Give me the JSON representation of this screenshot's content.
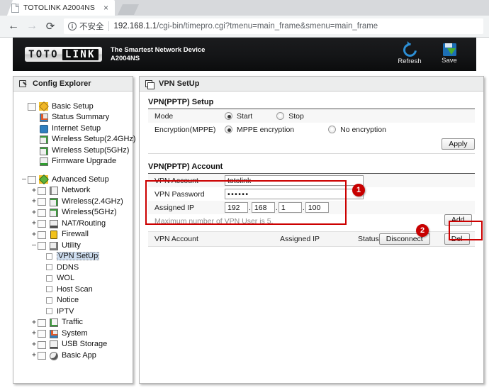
{
  "browser": {
    "tab": {
      "title": "TOTOLINK A2004NS",
      "close_label": "×"
    },
    "nav": {
      "back": "←",
      "forward": "→",
      "reload": "⟳"
    },
    "omnibox": {
      "security_icon_glyph": "i",
      "security_text": "不安全",
      "url_host": "192.168.1.1",
      "url_path": "/cgi-bin/timepro.cgi?tmenu=main_frame&smenu=main_frame"
    }
  },
  "header": {
    "logo_part1": "TOTO",
    "logo_part2": "LINK",
    "tagline_line1": "The Smartest Network Device",
    "tagline_line2": "A2004NS",
    "actions": [
      {
        "name": "refresh",
        "label": "Refresh"
      },
      {
        "name": "save",
        "label": "Save"
      }
    ]
  },
  "sidebar": {
    "title": "Config Explorer",
    "basic": {
      "label": "Basic Setup",
      "children": [
        {
          "label": "Status Summary"
        },
        {
          "label": "Internet Setup"
        },
        {
          "label": "Wireless Setup(2.4GHz)"
        },
        {
          "label": "Wireless Setup(5GHz)"
        },
        {
          "label": "Firmware Upgrade"
        }
      ]
    },
    "advanced": {
      "label": "Advanced Setup",
      "expander": "–",
      "children": [
        {
          "label": "Network",
          "expander": "+"
        },
        {
          "label": "Wireless(2.4GHz)",
          "expander": "+"
        },
        {
          "label": "Wireless(5GHz)",
          "expander": "+"
        },
        {
          "label": "NAT/Routing",
          "expander": "+"
        },
        {
          "label": "Firewall",
          "expander": "+"
        },
        {
          "label": "Utility",
          "expander": "–"
        }
      ],
      "utility_children": [
        {
          "label": "VPN SetUp",
          "selected": true
        },
        {
          "label": "DDNS",
          "selected": false
        },
        {
          "label": "WOL",
          "selected": false
        },
        {
          "label": "Host Scan",
          "selected": false
        },
        {
          "label": "Notice",
          "selected": false
        },
        {
          "label": "IPTV",
          "selected": false
        }
      ]
    },
    "tail": [
      {
        "label": "Traffic",
        "expander": "+"
      },
      {
        "label": "System",
        "expander": "+"
      },
      {
        "label": "USB Storage",
        "expander": "+"
      },
      {
        "label": "Basic App",
        "expander": "+"
      }
    ]
  },
  "main": {
    "panel_title": "VPN SetUp",
    "setup": {
      "heading": "VPN(PPTP) Setup",
      "mode_label": "Mode",
      "mode_options": [
        {
          "label": "Start",
          "selected": true
        },
        {
          "label": "Stop",
          "selected": false
        }
      ],
      "encryption_label": "Encryption(MPPE)",
      "encryption_options": [
        {
          "label": "MPPE encryption",
          "selected": true
        },
        {
          "label": "No encryption",
          "selected": false
        }
      ],
      "apply_label": "Apply"
    },
    "account": {
      "heading": "VPN(PPTP) Account",
      "account_label": "VPN Account",
      "account_value": "totolink",
      "password_label": "VPN Password",
      "password_value": "••••••",
      "assigned_ip_label": "Assigned IP",
      "assigned_ip": [
        "192",
        "168",
        "1",
        "100"
      ],
      "ip_separator": ".",
      "note": "Maximum number of VPN User is 5.",
      "add_label": "Add"
    },
    "table": {
      "columns": [
        "VPN Account",
        "Assigned IP",
        "Status"
      ],
      "disconnect_label": "Disconnect",
      "del_label": "Del",
      "rows": []
    },
    "annotations": [
      {
        "badge": "1"
      },
      {
        "badge": "2"
      }
    ]
  },
  "colors": {
    "accent_red": "#c80000",
    "header_bg": "#141517",
    "selection_blue": "#cfdef0",
    "refresh_blue": "#2d8fd5",
    "save_green": "#4cae2e"
  }
}
